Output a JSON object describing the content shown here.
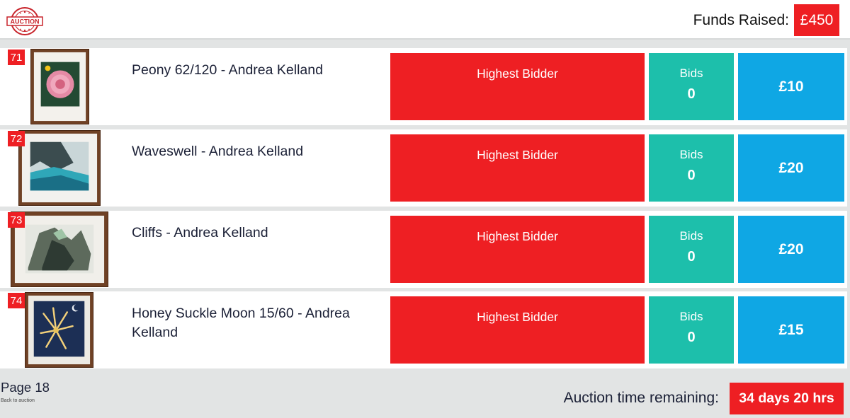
{
  "header": {
    "logo_text": "AUCTION",
    "funds_label": "Funds Raised:",
    "funds_value": "£450"
  },
  "lots": [
    {
      "number": "71",
      "title": "Peony 62/120 - Andrea Kelland",
      "bidder_label": "Highest Bidder",
      "bids_label": "Bids",
      "bids_count": "0",
      "price": "£10"
    },
    {
      "number": "72",
      "title": "Waveswell - Andrea Kelland",
      "bidder_label": "Highest Bidder",
      "bids_label": "Bids",
      "bids_count": "0",
      "price": "£20"
    },
    {
      "number": "73",
      "title": "Cliffs - Andrea Kelland",
      "bidder_label": "Highest Bidder",
      "bids_label": "Bids",
      "bids_count": "0",
      "price": "£20"
    },
    {
      "number": "74",
      "title": "Honey Suckle Moon 15/60 - Andrea Kelland",
      "bidder_label": "Highest Bidder",
      "bids_label": "Bids",
      "bids_count": "0",
      "price": "£15"
    }
  ],
  "footer": {
    "page_label": "Page 18",
    "back_link": "Back to auction",
    "time_label": "Auction time remaining:",
    "time_value": "34 days 20 hrs"
  },
  "colors": {
    "accent_red": "#ee1f23",
    "bids_teal": "#1dbfab",
    "price_blue": "#0fa7e4",
    "background": "#e2e4e4"
  }
}
